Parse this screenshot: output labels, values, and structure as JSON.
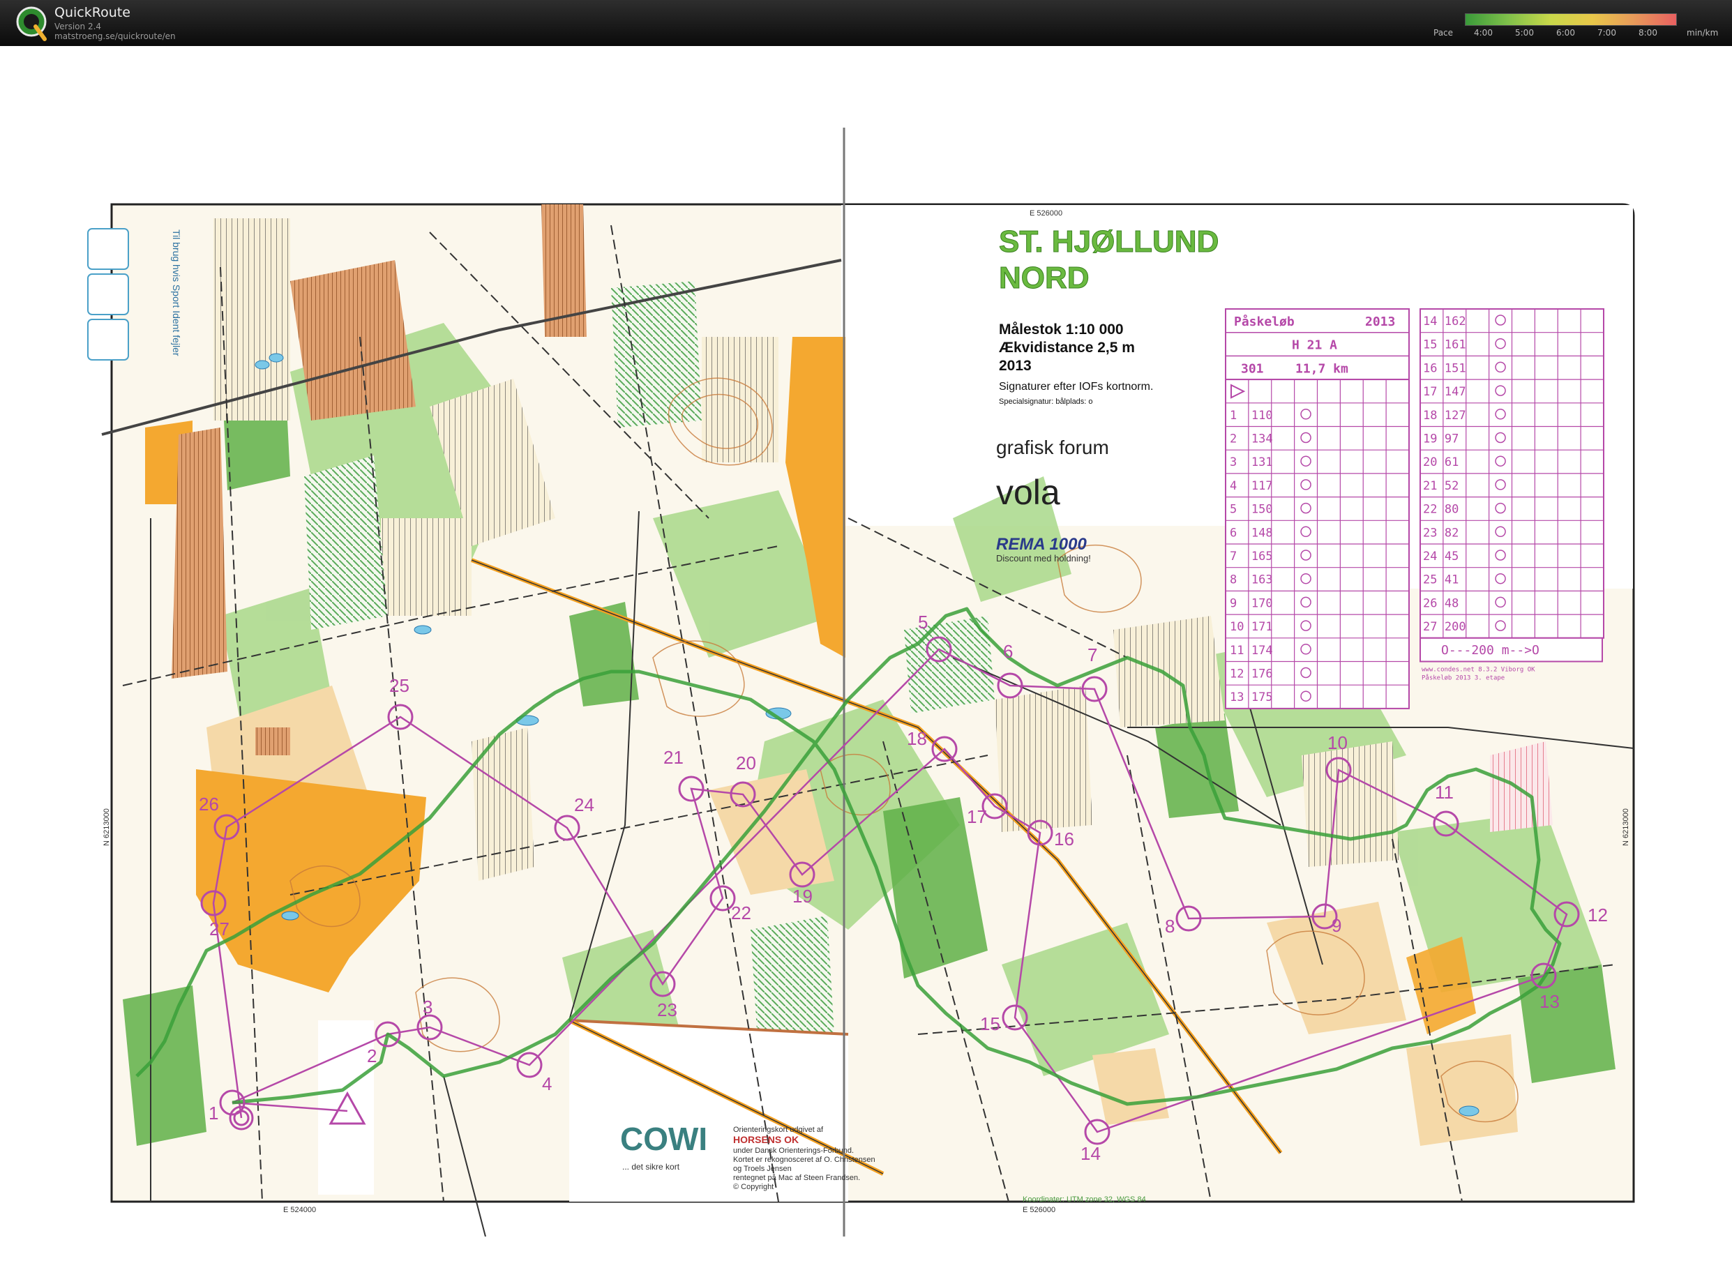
{
  "app": {
    "title": "QuickRoute",
    "version": "Version 2.4",
    "url": "matstroeng.se/quickroute/en"
  },
  "pace_legend": {
    "label": "Pace",
    "ticks": [
      "4:00",
      "5:00",
      "6:00",
      "7:00",
      "8:00"
    ],
    "unit": "min/km",
    "colors": [
      "#3a9a3a",
      "#7fc04a",
      "#c8d84a",
      "#e8c84a",
      "#e89a5a",
      "#e86060"
    ]
  },
  "map": {
    "title_line1": "ST. HJØLLUND",
    "title_line2": "NORD",
    "scale": "Målestok 1:10 000",
    "contour": "Ækvidistance 2,5 m",
    "year": "2013",
    "signature_note": "Signaturer efter IOFs kortnorm.",
    "special_signature": "Specialsignatur: bålplads: o",
    "sponsor1": "grafisk forum",
    "sponsor2": "vola",
    "sponsor3": "REMA 1000",
    "sponsor3_sub": "Discount med holdning!",
    "cowi": "COWI",
    "cowi_sub": "... det sikre kort",
    "publisher_line1": "Orienteringskort udgivet af",
    "publisher_club": "HORSENS OK",
    "publisher_line2": "under Dansk Orienterings-Forbund.",
    "publisher_line3": "Kortet er rekognosceret af O. Christensen",
    "publisher_line4": "og Troels Jensen",
    "publisher_line5": "rentegnet på Mac af Steen Frandsen.",
    "copyright": "© Copyright",
    "coord_e1": "E 526000",
    "coord_e2": "E 524000",
    "coord_e3": "E 526000",
    "coord_n1": "N 6213000",
    "coord_n2": "N 6213000",
    "coord_note": "Koordinater: UTM zone 32, WGS 84",
    "side_text": "Til brug hvis Sport Ident fejler",
    "cd_footer1": "www.condes.net 8.3.2 Viborg OK",
    "cd_footer2": "Påskeløb 2013 3. etape"
  },
  "control_desc": {
    "event": "Påskeløb",
    "year": "2013",
    "class": "H 21 A",
    "course_code": "301",
    "length": "11,7 km",
    "finish_text": "O---200 m-->O",
    "left_rows": [
      {
        "n": "1",
        "code": "110"
      },
      {
        "n": "2",
        "code": "134"
      },
      {
        "n": "3",
        "code": "131"
      },
      {
        "n": "4",
        "code": "117"
      },
      {
        "n": "5",
        "code": "150"
      },
      {
        "n": "6",
        "code": "148"
      },
      {
        "n": "7",
        "code": "165"
      },
      {
        "n": "8",
        "code": "163"
      },
      {
        "n": "9",
        "code": "170"
      },
      {
        "n": "10",
        "code": "171"
      },
      {
        "n": "11",
        "code": "174"
      },
      {
        "n": "12",
        "code": "176"
      },
      {
        "n": "13",
        "code": "175"
      }
    ],
    "right_rows": [
      {
        "n": "14",
        "code": "162"
      },
      {
        "n": "15",
        "code": "161"
      },
      {
        "n": "16",
        "code": "151"
      },
      {
        "n": "17",
        "code": "147"
      },
      {
        "n": "18",
        "code": "127"
      },
      {
        "n": "19",
        "code": "97"
      },
      {
        "n": "20",
        "code": "61"
      },
      {
        "n": "21",
        "code": "52"
      },
      {
        "n": "22",
        "code": "80"
      },
      {
        "n": "23",
        "code": "82"
      },
      {
        "n": "24",
        "code": "45"
      },
      {
        "n": "25",
        "code": "41"
      },
      {
        "n": "26",
        "code": "48"
      },
      {
        "n": "27",
        "code": "200"
      }
    ]
  },
  "controls": [
    {
      "label": "1"
    },
    {
      "label": "2"
    },
    {
      "label": "3"
    },
    {
      "label": "4"
    },
    {
      "label": "5"
    },
    {
      "label": "6"
    },
    {
      "label": "7"
    },
    {
      "label": "8"
    },
    {
      "label": "9"
    },
    {
      "label": "10"
    },
    {
      "label": "11"
    },
    {
      "label": "12"
    },
    {
      "label": "13"
    },
    {
      "label": "14"
    },
    {
      "label": "15"
    },
    {
      "label": "16"
    },
    {
      "label": "17"
    },
    {
      "label": "18"
    },
    {
      "label": "19"
    },
    {
      "label": "20"
    },
    {
      "label": "21"
    },
    {
      "label": "22"
    },
    {
      "label": "23"
    },
    {
      "label": "24"
    },
    {
      "label": "25"
    },
    {
      "label": "26"
    },
    {
      "label": "27"
    }
  ]
}
